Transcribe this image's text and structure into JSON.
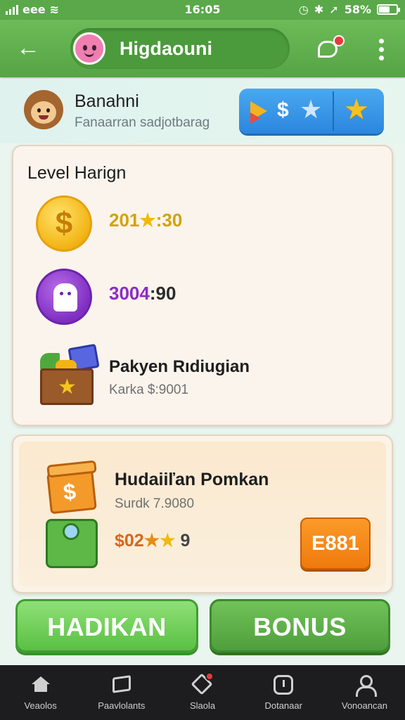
{
  "status_bar": {
    "carrier": "eee",
    "time": "16:05",
    "battery": "58%",
    "battery_level": 0.58
  },
  "app_bar": {
    "back_icon": "arrow-left-icon",
    "title": "Higdaouni",
    "chat_icon": "chat-bubble-icon",
    "menu_icon": "more-vertical-icon"
  },
  "profile": {
    "name": "Banahni",
    "subtitle": "Fanaarran sadjotbarag",
    "reward_icons": [
      "play-icon",
      "dollar-icon",
      "star-icon"
    ],
    "favorite_icon": "star-icon"
  },
  "level_card": {
    "title": "Level Harign",
    "rows": [
      {
        "icon": "gold-coin-icon",
        "value_prefix": "201",
        "value_suffix": ":30"
      },
      {
        "icon": "purple-gem-icon",
        "value_a": "3004",
        "value_b": ":90"
      },
      {
        "icon": "treasure-chest-icon",
        "title": "Pakyen Rıdiugian",
        "subtitle": "Karka $:9001"
      }
    ]
  },
  "bonus_card": {
    "title": "Hudaiiľan Pomkan",
    "subtitle": "Surdk 7.9080",
    "value_prefix": "$02",
    "value_suffix": "9",
    "button_label": "E881",
    "icons": [
      "orange-gift-box-icon",
      "green-camera-box-icon"
    ]
  },
  "actions": {
    "primary_label": "HADIKAN",
    "secondary_label": "BONUS"
  },
  "bottom_nav": {
    "items": [
      {
        "label": "Veaolos",
        "icon": "home-icon"
      },
      {
        "label": "Paavlolants",
        "icon": "book-icon"
      },
      {
        "label": "Slaola",
        "icon": "tag-icon"
      },
      {
        "label": "Dotanaar",
        "icon": "clock-icon"
      },
      {
        "label": "Vonoancan",
        "icon": "user-icon"
      }
    ]
  },
  "colors": {
    "app_bar": "#5aa84a",
    "primary_green": "#59c043",
    "reward_blue": "#2b86de",
    "code_orange": "#ef7a0c",
    "nav_background": "#1d1d1f"
  }
}
